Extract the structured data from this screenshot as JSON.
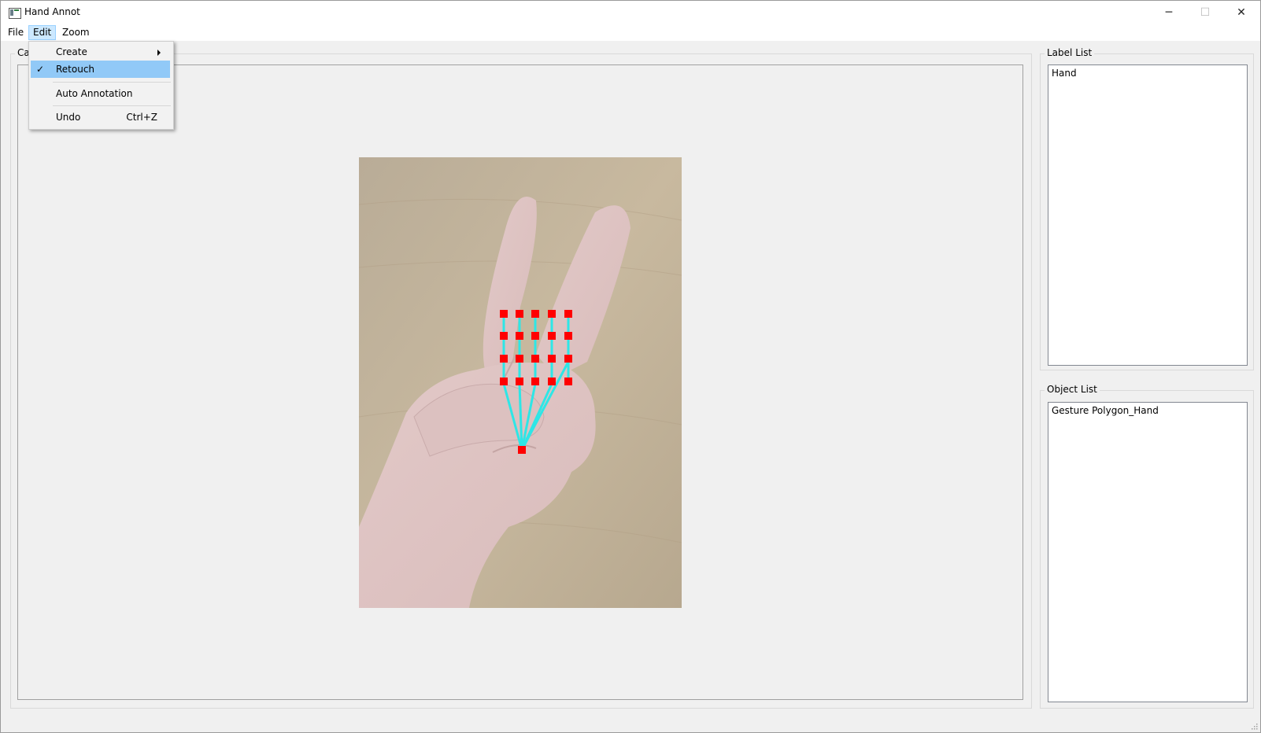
{
  "window": {
    "title": "Hand Annot",
    "controls": {
      "minimize": "─",
      "maximize": "☐",
      "close": "✕"
    }
  },
  "menubar": {
    "items": [
      "File",
      "Edit",
      "Zoom"
    ]
  },
  "edit_menu": {
    "items": [
      {
        "label": "Create",
        "has_submenu": true
      },
      {
        "label": "Retouch",
        "checked": true
      },
      {
        "label": "Auto Annotation"
      },
      {
        "label": "Undo",
        "shortcut": "Ctrl+Z"
      }
    ]
  },
  "canvas_panel": {
    "title": "Canvas",
    "visible_title": "Ca"
  },
  "label_list": {
    "title": "Label List",
    "items": [
      "Hand"
    ]
  },
  "object_list": {
    "title": "Object List",
    "items": [
      "Gesture Polygon_Hand"
    ]
  },
  "colors": {
    "keypoint": "#ff0000",
    "skeleton": "#2ee6e6",
    "menu_highlight": "#91c9f7"
  }
}
